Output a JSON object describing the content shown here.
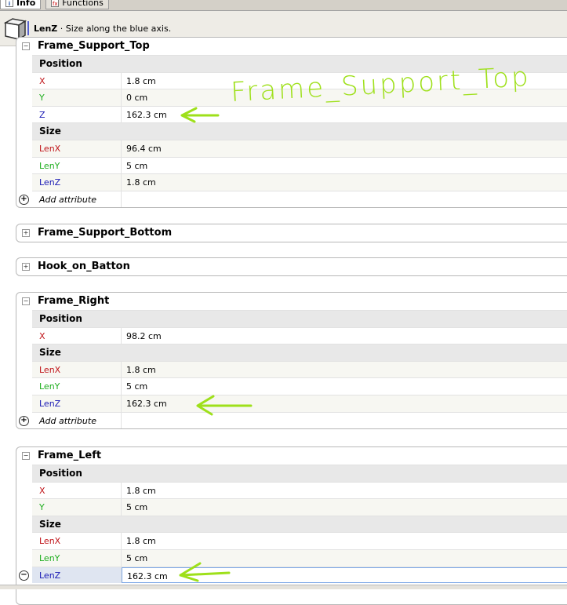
{
  "tabs": [
    {
      "label": "Info",
      "icon": "info-icon"
    },
    {
      "label": "Functions",
      "icon": "fx-icon"
    }
  ],
  "header": {
    "attr": "LenZ",
    "desc": "· Size along the blue axis."
  },
  "annotation": {
    "text": "Frame_Support_Top",
    "color": "#9ee01a"
  },
  "colors": {
    "x": "#c0151a",
    "y": "#1fae1f",
    "z": "#1a1ab5"
  },
  "panels": [
    {
      "title": "Frame_Support_Top",
      "position_label": "Position",
      "size_label": "Size",
      "x": "1.8 cm",
      "y": "0 cm",
      "z": "162.3 cm",
      "lenx": "96.4 cm",
      "leny": "5 cm",
      "lenz": "1.8 cm",
      "add": "Add attribute"
    },
    {
      "title": "Frame_Support_Bottom"
    },
    {
      "title": "Hook_on_Batton"
    },
    {
      "title": "Frame_Right",
      "position_label": "Position",
      "size_label": "Size",
      "x": "98.2 cm",
      "lenx": "1.8 cm",
      "leny": "5 cm",
      "lenz": "162.3 cm",
      "add": "Add attribute"
    },
    {
      "title": "Frame_Left",
      "position_label": "Position",
      "size_label": "Size",
      "x": "1.8 cm",
      "y": "5 cm",
      "lenx": "1.8 cm",
      "leny": "5 cm",
      "lenz": "162.3 cm"
    }
  ],
  "labels": {
    "x": "X",
    "y": "Y",
    "z": "Z",
    "lenx": "LenX",
    "leny": "LenY",
    "lenz": "LenZ"
  }
}
